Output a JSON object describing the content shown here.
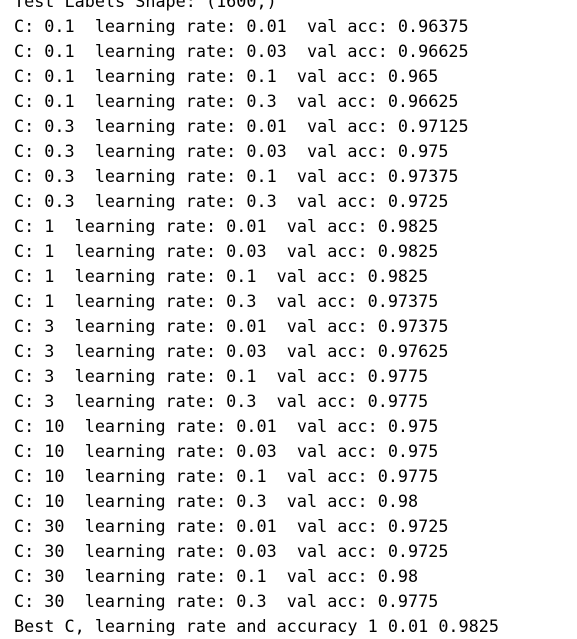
{
  "console": {
    "lines": [
      "Test Labels Shape: (1600,)",
      "C: 0.1  learning rate: 0.01  val acc: 0.96375",
      "C: 0.1  learning rate: 0.03  val acc: 0.96625",
      "C: 0.1  learning rate: 0.1  val acc: 0.965",
      "C: 0.1  learning rate: 0.3  val acc: 0.96625",
      "C: 0.3  learning rate: 0.01  val acc: 0.97125",
      "C: 0.3  learning rate: 0.03  val acc: 0.975",
      "C: 0.3  learning rate: 0.1  val acc: 0.97375",
      "C: 0.3  learning rate: 0.3  val acc: 0.9725",
      "C: 1  learning rate: 0.01  val acc: 0.9825",
      "C: 1  learning rate: 0.03  val acc: 0.9825",
      "C: 1  learning rate: 0.1  val acc: 0.9825",
      "C: 1  learning rate: 0.3  val acc: 0.97375",
      "C: 3  learning rate: 0.01  val acc: 0.97375",
      "C: 3  learning rate: 0.03  val acc: 0.97625",
      "C: 3  learning rate: 0.1  val acc: 0.9775",
      "C: 3  learning rate: 0.3  val acc: 0.9775",
      "C: 10  learning rate: 0.01  val acc: 0.975",
      "C: 10  learning rate: 0.03  val acc: 0.975",
      "C: 10  learning rate: 0.1  val acc: 0.9775",
      "C: 10  learning rate: 0.3  val acc: 0.98",
      "C: 30  learning rate: 0.01  val acc: 0.9725",
      "C: 30  learning rate: 0.03  val acc: 0.9725",
      "C: 30  learning rate: 0.1  val acc: 0.98",
      "C: 30  learning rate: 0.3  val acc: 0.9775",
      "Best C, learning rate and accuracy 1 0.01 0.9825"
    ]
  }
}
